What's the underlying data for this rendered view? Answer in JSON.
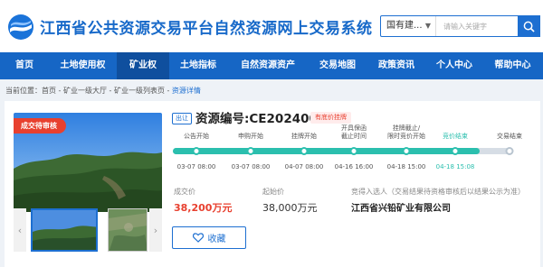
{
  "site": {
    "title": "江西省公共资源交易平台自然资源网上交易系统"
  },
  "search": {
    "select_value": "国有建...",
    "placeholder": "请输入关键字"
  },
  "nav": {
    "items": [
      {
        "label": "首页"
      },
      {
        "label": "土地使用权"
      },
      {
        "label": "矿业权",
        "active": true
      },
      {
        "label": "土地指标"
      },
      {
        "label": "自然资源资产"
      },
      {
        "label": "交易地图"
      },
      {
        "label": "政策资讯"
      },
      {
        "label": "个人中心"
      },
      {
        "label": "帮助中心"
      }
    ]
  },
  "breadcrumb": {
    "prefix": "当前位置：",
    "path": "首页 - 矿业一级大厅 - 矿业一级列表页 - ",
    "current": "资源详情"
  },
  "listing": {
    "status_tag": "成交待审核",
    "sell_badge": "出让",
    "asset_no": "资源编号:CE2024002",
    "type_badge": "有底价挂牌",
    "timeline": [
      {
        "label": "公告开始",
        "date": "03-07 08:00",
        "state": "done"
      },
      {
        "label": "申购开始",
        "date": "03-07 08:00",
        "state": "done"
      },
      {
        "label": "挂牌开始",
        "date": "04-07 08:00",
        "state": "done"
      },
      {
        "label": "开具保函\n截止时间",
        "date": "04-16 16:00",
        "state": "done"
      },
      {
        "label": "挂牌截止/\n限时竞价开始",
        "date": "04-18 15:00",
        "state": "done"
      },
      {
        "label": "竞价结束",
        "date": "04-18 15:08",
        "state": "current"
      },
      {
        "label": "交易结束",
        "date": "",
        "state": "pending"
      }
    ],
    "deal_price_label": "成交价",
    "deal_price": "38,200万元",
    "start_price_label": "起始价",
    "start_price": "38,000万元",
    "winner_label": "竞得入选人（交易结果待资格审核后以结果公示为准）",
    "winner": "江西省兴铅矿业有限公司",
    "favorite_label": "收藏"
  },
  "colors": {
    "brand": "#1666c5",
    "accent": "#1d6fd1",
    "progress": "#2bbfae",
    "price": "#e8402f"
  }
}
